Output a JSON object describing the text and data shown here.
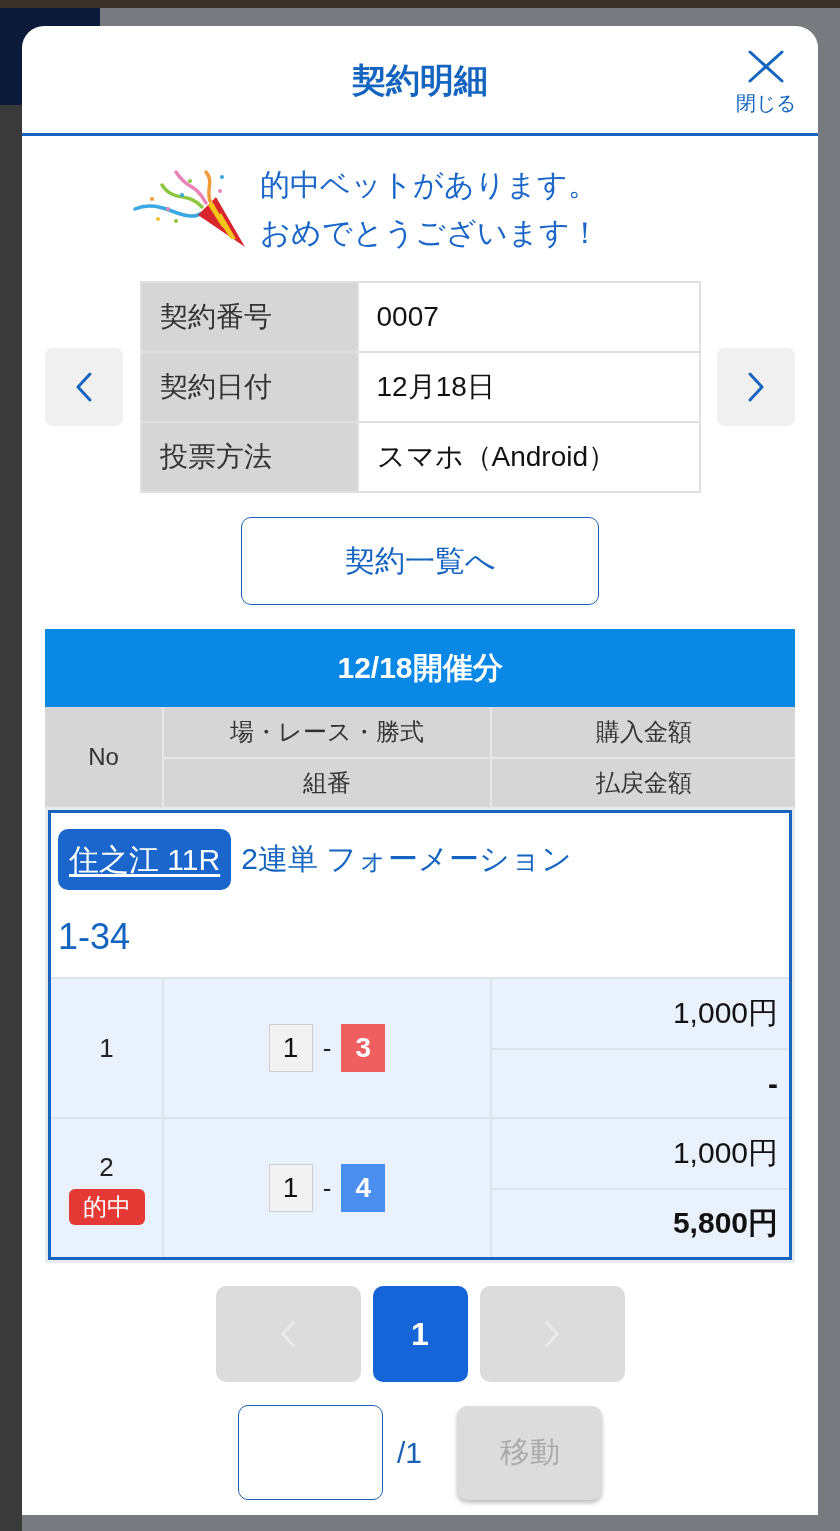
{
  "modal": {
    "title": "契約明細",
    "close_label": "閉じる"
  },
  "congrats": {
    "lines": [
      "的中ベットがあります。",
      "おめでとうございます！"
    ]
  },
  "contract": {
    "rows": [
      {
        "label": "契約番号",
        "value": "0007"
      },
      {
        "label": "契約日付",
        "value": "12月18日"
      },
      {
        "label": "投票方法",
        "value": "スマホ（Android）"
      }
    ]
  },
  "list_button": "契約一覧へ",
  "bets": {
    "date_header": "12/18開催分",
    "columns": {
      "no": "No",
      "race": "場・レース・勝式",
      "combo": "組番",
      "purchase": "購入金額",
      "payout": "払戻金額"
    },
    "races": [
      {
        "race": "住之江 11R",
        "bet_type": "2連単 フォーメーション",
        "selection": "1-34",
        "rows": [
          {
            "no": "1",
            "combo": [
              {
                "number": "1",
                "color": "#f2f2f2"
              },
              {
                "number": "3",
                "color": "#ef5f5f"
              }
            ],
            "separator": "-",
            "purchase": "1,000円",
            "payout": "-"
          },
          {
            "no": "2",
            "badge": "的中",
            "combo": [
              {
                "number": "1",
                "color": "#f2f2f2"
              },
              {
                "number": "4",
                "color": "#4a8ef0"
              }
            ],
            "separator": "-",
            "purchase": "1,000円",
            "payout": "5,800円"
          }
        ]
      }
    ]
  },
  "pagination": {
    "prev": {
      "disabled": true
    },
    "pages": [
      {
        "label": "1",
        "selected": true
      }
    ],
    "next": {
      "disabled": true
    }
  },
  "page_jump": {
    "total": "/1",
    "button": {
      "label": "移動",
      "disabled": true
    }
  }
}
